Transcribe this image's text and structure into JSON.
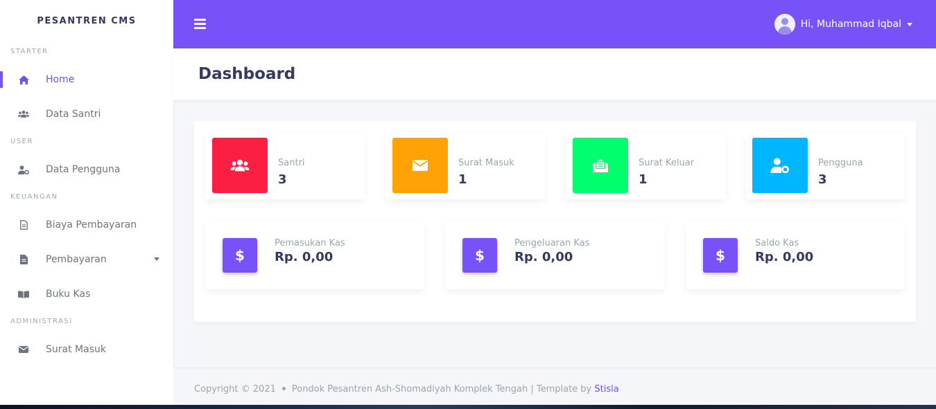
{
  "sidebar": {
    "brand": "PESANTREN CMS",
    "sections": {
      "starter": "STARTER",
      "user": "USER",
      "keuangan": "KEUANGAN",
      "administrasi": "ADMINISTRASI"
    },
    "items": {
      "home": "Home",
      "data_santri": "Data Santri",
      "data_pengguna": "Data Pengguna",
      "biaya_pembayaran": "Biaya Pembayaran",
      "pembayaran": "Pembayaran",
      "buku_kas": "Buku Kas",
      "surat_masuk": "Surat Masuk"
    }
  },
  "topbar": {
    "user_greeting": "Hi, Muhammad Iqbal"
  },
  "page": {
    "title": "Dashboard"
  },
  "stats": {
    "santri": {
      "label": "Santri",
      "value": "3",
      "color": "#fc1f41",
      "icon": "users-icon"
    },
    "surat_masuk": {
      "label": "Surat Masuk",
      "value": "1",
      "color": "#ffa304",
      "icon": "envelope-icon"
    },
    "surat_keluar": {
      "label": "Surat Keluar",
      "value": "1",
      "color": "#00ff6c",
      "icon": "envelope-open-text-icon"
    },
    "pengguna": {
      "label": "Pengguna",
      "value": "3",
      "color": "#00b6ff",
      "icon": "user-cog-icon"
    }
  },
  "kas": {
    "pemasukan": {
      "label": "Pemasukan Kas",
      "value": "Rp. 0,00",
      "icon": "dollar-icon"
    },
    "pengeluaran": {
      "label": "Pengeluaran Kas",
      "value": "Rp. 0,00",
      "icon": "dollar-icon"
    },
    "saldo": {
      "label": "Saldo Kas",
      "value": "Rp. 0,00",
      "icon": "dollar-icon"
    }
  },
  "footer": {
    "copyright": "Copyright © 2021",
    "text": "Pondok Pesantren Ash-Shomadiyah Komplek Tengah | Template by",
    "link": "Stisla"
  },
  "theme": {
    "accent": "#7752f6",
    "active_text": "#6c50f4"
  }
}
